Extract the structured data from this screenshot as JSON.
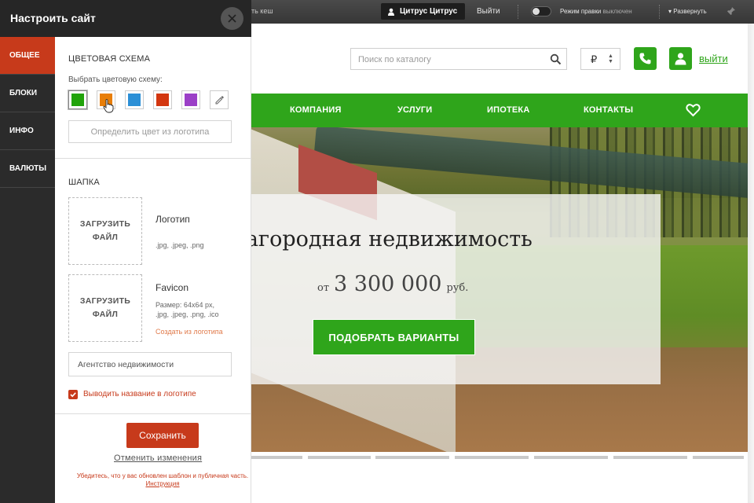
{
  "adminbar": {
    "cache_label": "ть кеш",
    "user_name": "Цитрус Цитрус",
    "logout": "Выйти",
    "edit_mode_label": "Режим правки",
    "edit_mode_state": "выключен",
    "expand": "Развернуть"
  },
  "header": {
    "search_placeholder": "Поиск по каталогу",
    "currency": "₽",
    "login": "выйти",
    "accent_color": "#2fa51b"
  },
  "nav": {
    "items": [
      "КОМПАНИЯ",
      "УСЛУГИ",
      "ИПОТЕКА",
      "КОНТАКТЫ"
    ]
  },
  "hero": {
    "title": "Загородная недвижимость",
    "price_from": "от",
    "price": "3 300 000",
    "price_currency": "руб.",
    "cta": "ПОДОБРАТЬ ВАРИАНТЫ"
  },
  "panel": {
    "title": "Настроить сайт",
    "tabs": [
      "ОБЩЕЕ",
      "БЛОКИ",
      "ИНФО",
      "ВАЛЮТЫ"
    ],
    "active_tab": "ОБЩЕЕ",
    "color_scheme": {
      "title": "ЦВЕТОВАЯ СХЕМА",
      "choose_label": "Выбрать цветовую схему:",
      "swatches": [
        "#21a30a",
        "#e87e08",
        "#2b8fd6",
        "#d3360f",
        "#9b3fc7"
      ],
      "selected": "#21a30a",
      "logo_color_button": "Определить цвет из логотипа"
    },
    "header_section": {
      "title": "ШАПКА",
      "logo_upload": "ЗАГРУЗИТЬ ФАЙЛ",
      "logo_title": "Логотип",
      "logo_formats": ".jpg, .jpeg, .png",
      "favicon_upload": "ЗАГРУЗИТЬ ФАЙЛ",
      "favicon_title": "Favicon",
      "favicon_size": "Размер: 64x64 px,",
      "favicon_formats": ".jpg, .jpeg, .png, .ico",
      "favicon_from_logo": "Создать из логотипа",
      "site_name_value": "Агентство недвижимости",
      "show_name_label": "Выводить название в логотипе",
      "show_name_checked": true
    },
    "save": "Сохранить",
    "cancel": "Отменить изменения",
    "notice": "Убедитесь, что у вас обновлен шаблон и публичная часть.",
    "notice_link": "Инструкция",
    "accent_color": "#c73a1b"
  }
}
